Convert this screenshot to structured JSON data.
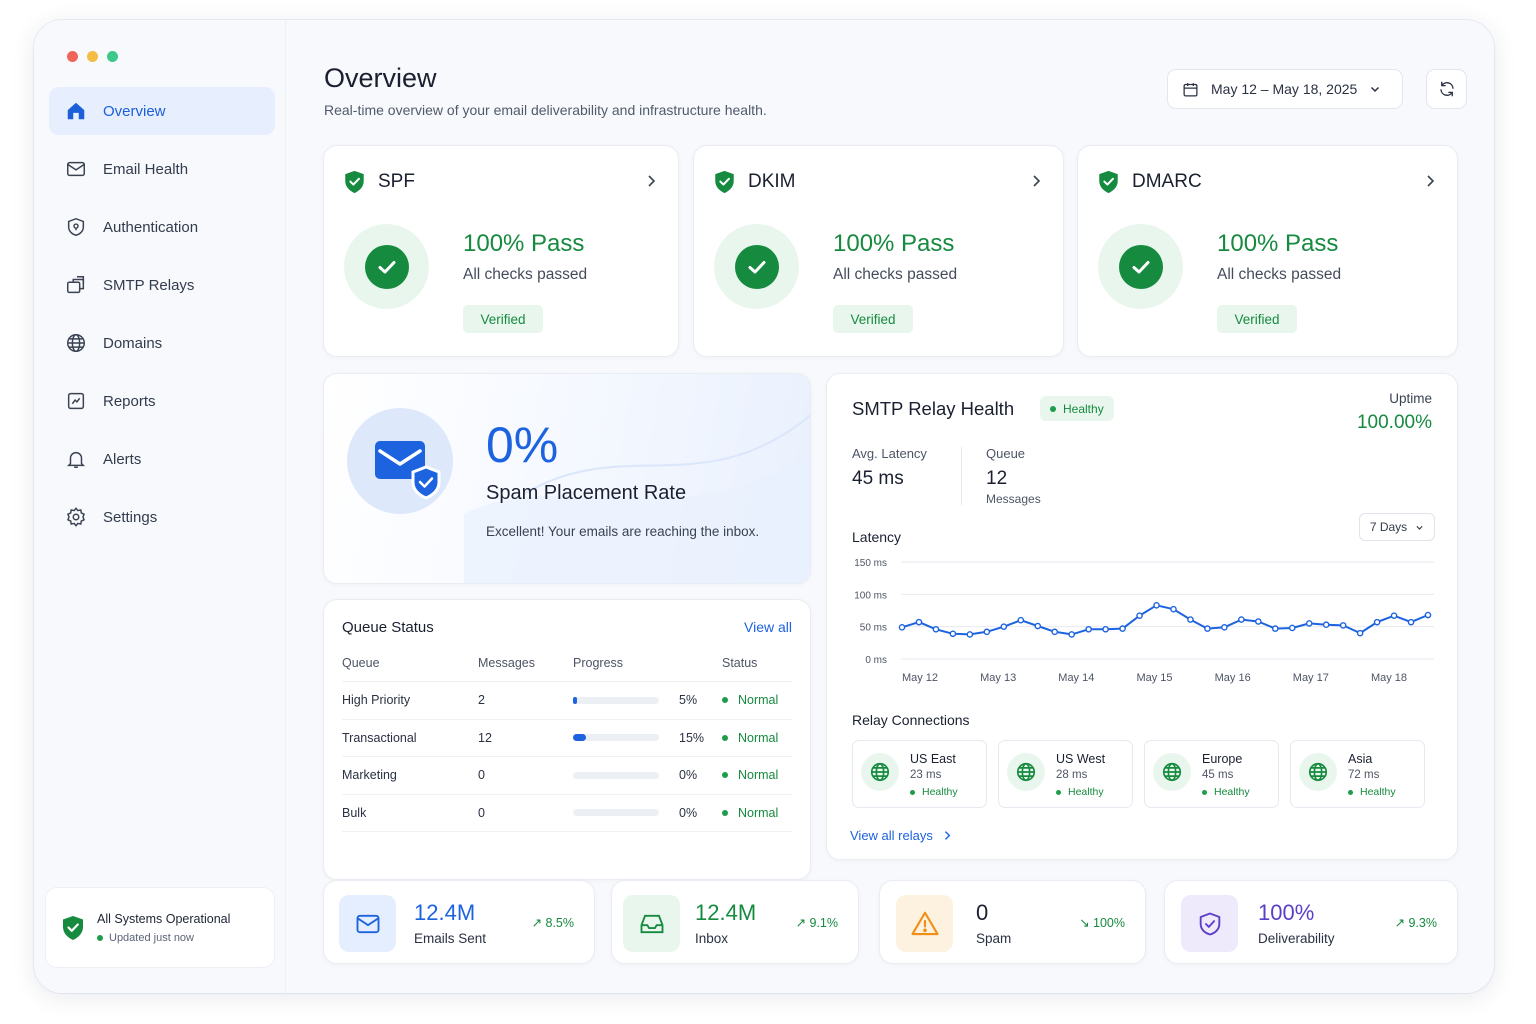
{
  "sidebar": {
    "items": [
      {
        "label": "Overview"
      },
      {
        "label": "Email Health"
      },
      {
        "label": "Authentication"
      },
      {
        "label": "SMTP Relays"
      },
      {
        "label": "Domains"
      },
      {
        "label": "Reports"
      },
      {
        "label": "Alerts"
      },
      {
        "label": "Settings"
      }
    ],
    "status": {
      "title": "All Systems Operational",
      "updated": "Updated just now"
    }
  },
  "header": {
    "title": "Overview",
    "subtitle": "Real-time overview of your email deliverability and infrastructure health.",
    "date_range": "May 12 – May 18, 2025"
  },
  "auth": [
    {
      "name": "SPF",
      "result": "100% Pass",
      "desc": "All checks passed",
      "badge": "Verified"
    },
    {
      "name": "DKIM",
      "result": "100% Pass",
      "desc": "All checks passed",
      "badge": "Verified"
    },
    {
      "name": "DMARC",
      "result": "100% Pass",
      "desc": "All checks passed",
      "badge": "Verified"
    }
  ],
  "spam": {
    "value": "0%",
    "label": "Spam Placement Rate",
    "desc": "Excellent! Your emails are reaching the inbox."
  },
  "relay": {
    "title": "SMTP Relay Health",
    "status": "Healthy",
    "uptime_label": "Uptime",
    "uptime_value": "100.00%",
    "latency_label": "Avg. Latency",
    "latency_value": "45 ms",
    "queue_label": "Queue",
    "queue_value": "12",
    "queue_unit": "Messages",
    "range": "7 Days",
    "connections_title": "Relay Connections",
    "view_all": "View all relays",
    "connections": [
      {
        "name": "US East",
        "latency": "23 ms",
        "status": "Healthy"
      },
      {
        "name": "US West",
        "latency": "28 ms",
        "status": "Healthy"
      },
      {
        "name": "Europe",
        "latency": "45 ms",
        "status": "Healthy"
      },
      {
        "name": "Asia",
        "latency": "72 ms",
        "status": "Healthy"
      }
    ]
  },
  "chart_data": {
    "type": "line",
    "title": "Latency",
    "xlabel": "",
    "ylabel": "",
    "ylim": [
      0,
      150
    ],
    "yticks": [
      "0 ms",
      "50 ms",
      "100 ms",
      "150 ms"
    ],
    "ytick_values": [
      0,
      50,
      100,
      150
    ],
    "categories": [
      "May 12",
      "May 13",
      "May 14",
      "May 15",
      "May 16",
      "May 17",
      "May 18"
    ],
    "series": [
      {
        "color": "#1d63e0",
        "values": [
          49,
          57,
          46,
          39,
          38,
          42,
          50,
          60,
          51,
          42,
          38,
          46,
          46,
          47,
          67,
          83,
          77,
          61,
          47,
          49,
          61,
          58,
          47,
          48,
          55,
          53,
          52,
          40,
          57,
          67,
          57,
          68
        ]
      }
    ]
  },
  "queue": {
    "title": "Queue Status",
    "view_all": "View all",
    "headers": [
      "Queue",
      "Messages",
      "Progress",
      "Status"
    ],
    "rows": [
      {
        "name": "High Priority",
        "messages": "2",
        "progress": 5,
        "progress_label": "5%",
        "status": "Normal"
      },
      {
        "name": "Transactional",
        "messages": "12",
        "progress": 15,
        "progress_label": "15%",
        "status": "Normal"
      },
      {
        "name": "Marketing",
        "messages": "0",
        "progress": 0,
        "progress_label": "0%",
        "status": "Normal"
      },
      {
        "name": "Bulk",
        "messages": "0",
        "progress": 0,
        "progress_label": "0%",
        "status": "Normal"
      }
    ]
  },
  "stats": [
    {
      "value": "12.4M",
      "label": "Emails Sent",
      "change": "↗ 8.5%",
      "color": "#1d63e0"
    },
    {
      "value": "12.4M",
      "label": "Inbox",
      "change": "↗ 9.1%",
      "color": "#168a3f"
    },
    {
      "value": "0",
      "label": "Spam",
      "change": "↘ 100%",
      "color": "#1a2030"
    },
    {
      "value": "100%",
      "label": "Deliverability",
      "change": "↗ 9.3%",
      "color": "#5b3fc7"
    }
  ]
}
